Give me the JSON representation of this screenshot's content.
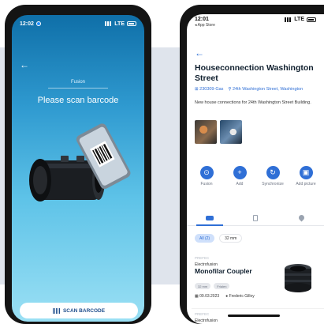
{
  "left_phone": {
    "status": {
      "time": "12:02",
      "network": "LTE"
    },
    "header_label": "Fusion",
    "title": "Please scan barcode",
    "scan_button": "SCAN BARCODE"
  },
  "right_phone": {
    "status": {
      "time": "12:01",
      "back_app": "◂ App Store",
      "network": "LTE"
    },
    "title": "Houseconnection Washington Street",
    "project_id": "230309-Gas",
    "address": "24th Washington Street, Washington",
    "description": "New house connections for 24th Washington Street Building.",
    "actions": [
      {
        "label": "Fusion",
        "icon": "fusion-icon",
        "glyph": "⊙"
      },
      {
        "label": "Add",
        "icon": "plus-icon",
        "glyph": "+"
      },
      {
        "label": "Synchronize",
        "icon": "sync-icon",
        "glyph": "↻"
      },
      {
        "label": "Add picture",
        "icon": "picture-icon",
        "glyph": "▣"
      }
    ],
    "tabs": [
      {
        "icon": "fittings-tab-icon",
        "active": true
      },
      {
        "icon": "document-tab-icon",
        "active": false
      },
      {
        "icon": "location-tab-icon",
        "active": false
      }
    ],
    "filters": [
      "All (2)",
      "32 mm"
    ],
    "item": {
      "code": "PREFEC",
      "category": "Electrofusion",
      "name": "Monofilar Coupler",
      "badges": [
        "32 mm",
        "Frialen"
      ],
      "date": "09.03.2023",
      "user": "Frederic Gilloy"
    },
    "item2": {
      "code": "PREFEC",
      "category": "Electrofusion"
    }
  },
  "colors": {
    "accent": "#2f6fd6",
    "gradient_top": "#0f6fa8",
    "gradient_bottom": "#9be0f4"
  }
}
